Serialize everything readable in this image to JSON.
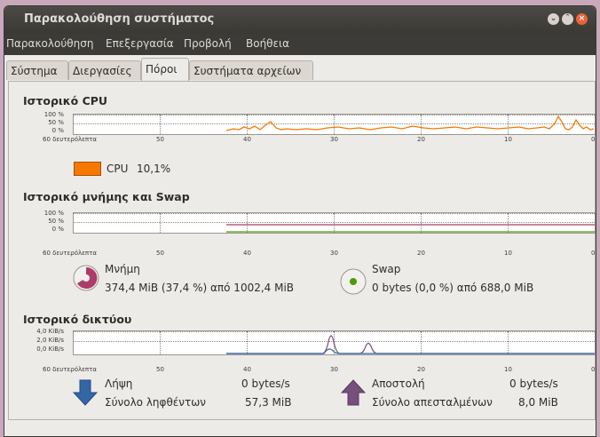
{
  "window": {
    "title": "Παρακολούθηση συστήματος"
  },
  "menu": [
    "Παρακολούθηση",
    "Επεξεργασία",
    "Προβολή",
    "Βοήθεια"
  ],
  "tabs": [
    "Σύστημα",
    "Διεργασίες",
    "Πόροι",
    "Συστήματα αρχείων"
  ],
  "active_tab": "Πόροι",
  "cpu": {
    "title": "Ιστορικό CPU",
    "y_ticks": [
      "100 %",
      "50 %",
      "0 %"
    ],
    "x_ticks": [
      "60 δευτερόλεπτα",
      "50",
      "40",
      "30",
      "20",
      "10",
      "0"
    ],
    "legend_label": "CPU",
    "legend_value": "10,1%",
    "color": "#f57900"
  },
  "memory": {
    "title": "Ιστορικό μνήμης και Swap",
    "y_ticks": [
      "100 %",
      "50 %",
      "0 %"
    ],
    "x_ticks": [
      "60 δευτερόλεπτα",
      "50",
      "40",
      "30",
      "20",
      "10",
      "0"
    ],
    "mem_label": "Μνήμη",
    "mem_value": "374,4 MiB (37,4 %) από 1002,4 MiB",
    "mem_color": "#ad3c6a",
    "swap_label": "Swap",
    "swap_value": "0 bytes (0,0 %) από 688,0 MiB",
    "swap_color": "#4e9a06"
  },
  "network": {
    "title": "Ιστορικό δικτύου",
    "y_ticks": [
      "4,0 KiB/s",
      "2,0 KiB/s",
      "0,0 KiB/s"
    ],
    "x_ticks": [
      "60 δευτερόλεπτα",
      "50",
      "40",
      "30",
      "20",
      "10",
      "0"
    ],
    "recv_label": "Λήψη",
    "recv_rate": "0 bytes/s",
    "recv_total_label": "Σύνολο ληφθέντων",
    "recv_total": "57,3 MiB",
    "recv_color": "#3465a4",
    "send_label": "Αποστολή",
    "send_rate": "0 bytes/s",
    "send_total_label": "Σύνολο απεσταλμένων",
    "send_total": "8,0 MiB",
    "send_color": "#75507b"
  }
}
